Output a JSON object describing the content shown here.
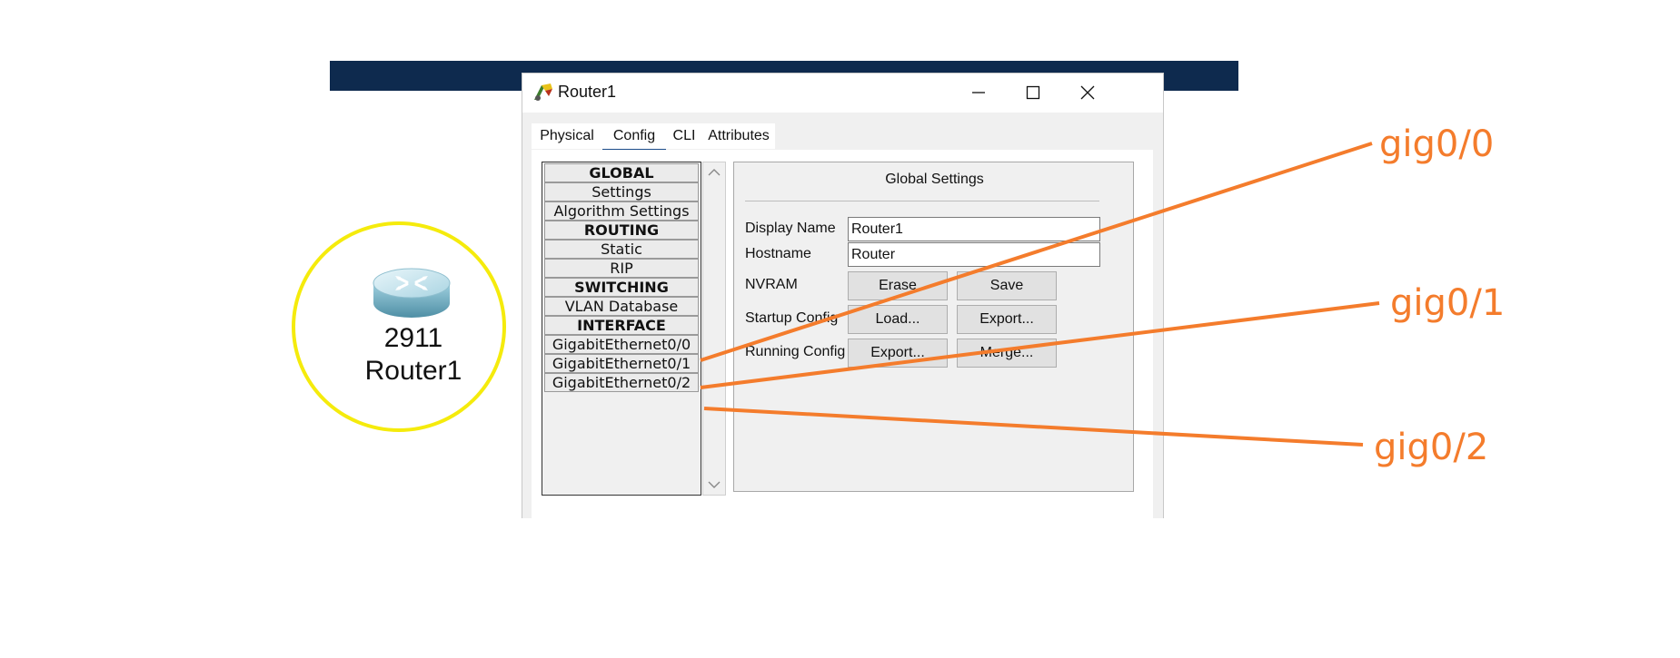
{
  "device": {
    "model": "2911",
    "name": "Router1",
    "icon": "router-icon",
    "highlight_color": "#f5eb0c"
  },
  "window": {
    "title": "Router1",
    "icon": "packet-tracer-icon",
    "controls": [
      "minimize-icon",
      "maximize-icon",
      "close-icon"
    ]
  },
  "tabs": [
    {
      "label": "Physical",
      "active": false
    },
    {
      "label": "Config",
      "active": true
    },
    {
      "label": "CLI",
      "active": false
    },
    {
      "label": "Attributes",
      "active": false
    }
  ],
  "nav": {
    "items": [
      {
        "label": "GLOBAL",
        "header": true
      },
      {
        "label": "Settings",
        "header": false
      },
      {
        "label": "Algorithm Settings",
        "header": false
      },
      {
        "label": "ROUTING",
        "header": true
      },
      {
        "label": "Static",
        "header": false
      },
      {
        "label": "RIP",
        "header": false
      },
      {
        "label": "SWITCHING",
        "header": true
      },
      {
        "label": "VLAN Database",
        "header": false
      },
      {
        "label": "INTERFACE",
        "header": true
      },
      {
        "label": "GigabitEthernet0/0",
        "header": false
      },
      {
        "label": "GigabitEthernet0/1",
        "header": false
      },
      {
        "label": "GigabitEthernet0/2",
        "header": false
      }
    ]
  },
  "panel": {
    "title": "Global Settings",
    "display_name_label": "Display Name",
    "display_name_value": "Router1",
    "hostname_label": "Hostname",
    "hostname_value": "Router",
    "nvram_label": "NVRAM",
    "erase_label": "Erase",
    "save_label": "Save",
    "startup_label": "Startup Config",
    "load_label": "Load...",
    "export_startup_label": "Export...",
    "running_label": "Running Config",
    "export_running_label": "Export...",
    "merge_label": "Merge..."
  },
  "annotations": {
    "color": "#f47c2c",
    "labels": [
      "gig0/0",
      "gig0/1",
      "gig0/2"
    ]
  },
  "colors": {
    "topbar": "#0e2a4e",
    "tab_underline": "#1b4c8a"
  }
}
